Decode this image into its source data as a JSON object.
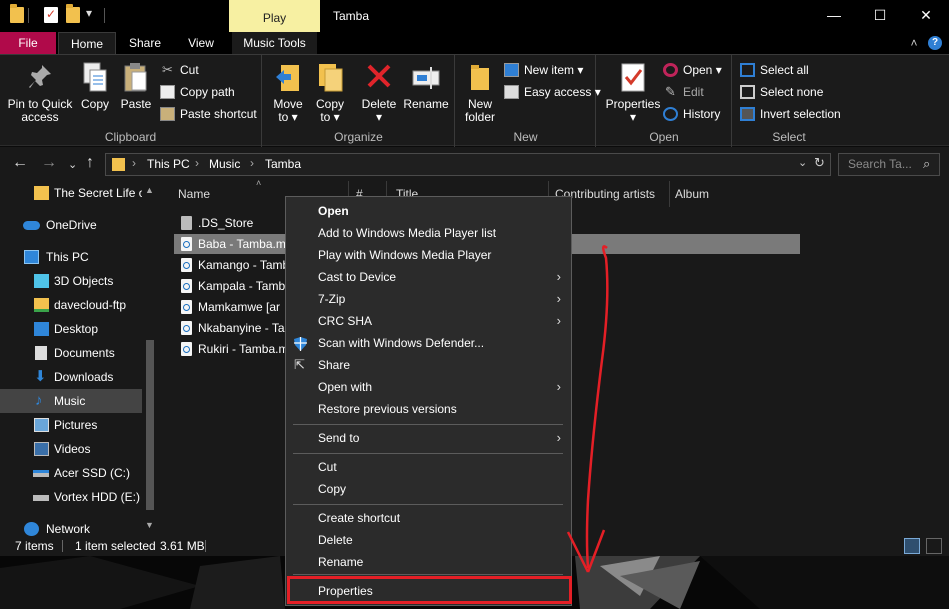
{
  "window": {
    "title": "Tamba",
    "contextual_tab": "Play",
    "controls": {
      "minimize": "—",
      "maximize": "☐",
      "close": "✕"
    }
  },
  "tabs": {
    "file": "File",
    "home": "Home",
    "share": "Share",
    "view": "View",
    "music_tools": "Music Tools",
    "collapse": "˄",
    "help": "?"
  },
  "ribbon": {
    "clipboard": {
      "label": "Clipboard",
      "pin": "Pin to Quick access",
      "copy": "Copy",
      "paste": "Paste",
      "cut": "Cut",
      "copy_path": "Copy path",
      "paste_shortcut": "Paste shortcut"
    },
    "organize": {
      "label": "Organize",
      "move_to": "Move to ▾",
      "copy_to": "Copy to ▾",
      "delete": "Delete ▾",
      "rename": "Rename"
    },
    "new": {
      "label": "New",
      "new_folder": "New folder",
      "new_item": "New item ▾",
      "easy_access": "Easy access ▾"
    },
    "open": {
      "label": "Open",
      "properties": "Properties ▾",
      "open": "Open ▾",
      "edit": "Edit",
      "history": "History"
    },
    "select": {
      "label": "Select",
      "select_all": "Select all",
      "select_none": "Select none",
      "invert": "Invert selection"
    }
  },
  "address": {
    "breadcrumb": [
      "This PC",
      "Music",
      "Tamba"
    ],
    "search_placeholder": "Search Ta..."
  },
  "nav": {
    "items": [
      {
        "label": "The Secret Life o",
        "icon": "folder-icon"
      },
      {
        "label": "OneDrive",
        "icon": "cloud-icon"
      },
      {
        "label": "This PC",
        "icon": "computer-icon"
      },
      {
        "label": "3D Objects",
        "icon": "cube-icon"
      },
      {
        "label": "davecloud-ftp",
        "icon": "network-drive-icon"
      },
      {
        "label": "Desktop",
        "icon": "desktop-icon"
      },
      {
        "label": "Documents",
        "icon": "documents-icon"
      },
      {
        "label": "Downloads",
        "icon": "download-icon"
      },
      {
        "label": "Music",
        "icon": "music-note-icon"
      },
      {
        "label": "Pictures",
        "icon": "pictures-icon"
      },
      {
        "label": "Videos",
        "icon": "videos-icon"
      },
      {
        "label": "Acer SSD (C:)",
        "icon": "drive-icon"
      },
      {
        "label": "Vortex HDD (E:)",
        "icon": "drive-icon"
      },
      {
        "label": "Network",
        "icon": "network-icon"
      }
    ]
  },
  "filelist": {
    "columns": [
      "Name",
      "#",
      "Title",
      "Contributing artists",
      "Album"
    ],
    "files": [
      ".DS_Store",
      "Baba - Tamba.m",
      "Kamango - Tamb",
      "Kampala - Tamb",
      "Mamkamwe [ar",
      "Nkabanyine - Ta",
      "Rukiri - Tamba.m"
    ]
  },
  "status": {
    "items": "7 items",
    "selected": "1 item selected",
    "size": "3.61 MB"
  },
  "context_menu": {
    "items": [
      "Open",
      "Add to Windows Media Player list",
      "Play with Windows Media Player",
      "Cast to Device",
      "7-Zip",
      "CRC SHA",
      "Scan with Windows Defender...",
      "Share",
      "Open with",
      "Restore previous versions",
      "Send to",
      "Cut",
      "Copy",
      "Create shortcut",
      "Delete",
      "Rename",
      "Properties"
    ]
  },
  "colors": {
    "file_tab": "#b00a4a",
    "highlight": "#e41f26",
    "folder": "#f2c14e"
  }
}
